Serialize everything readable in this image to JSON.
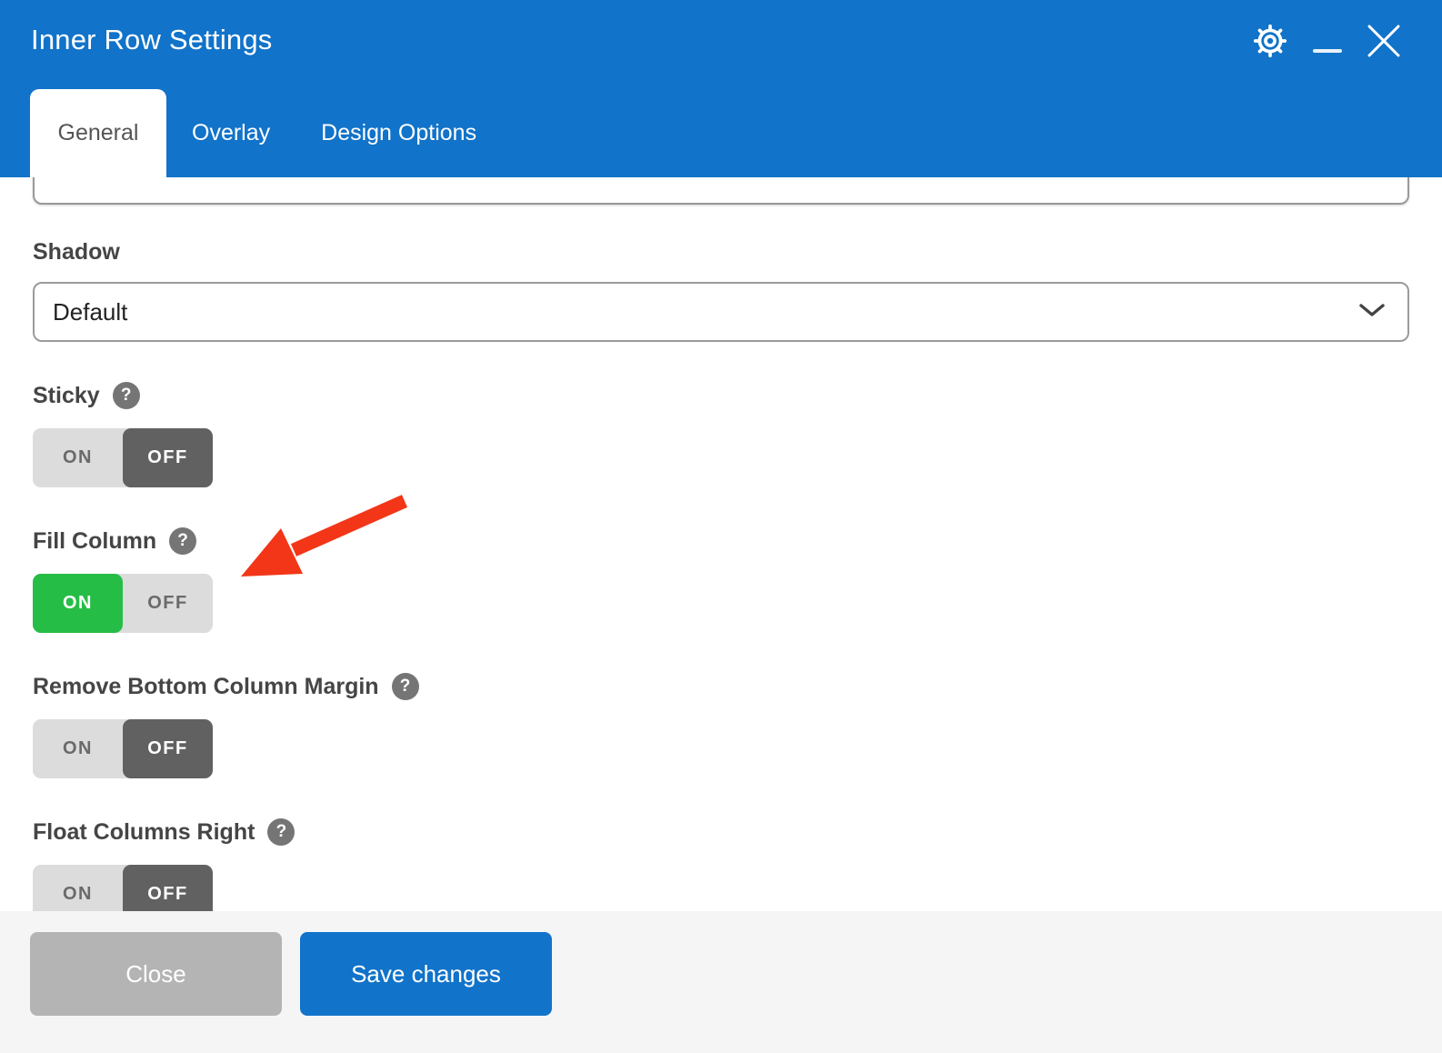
{
  "header": {
    "title": "Inner Row Settings",
    "icons": [
      "settings-icon",
      "minimize-icon",
      "close-icon"
    ]
  },
  "tabs": [
    {
      "label": "General",
      "active": true
    },
    {
      "label": "Overlay",
      "active": false
    },
    {
      "label": "Design Options",
      "active": false
    }
  ],
  "form": {
    "shadow_label": "Shadow",
    "shadow_value": "Default",
    "sections": [
      {
        "label": "Sticky",
        "value": "OFF",
        "has_help": true
      },
      {
        "label": "Fill Column",
        "value": "ON",
        "has_help": true
      },
      {
        "label": "Remove Bottom Column Margin",
        "value": "OFF",
        "has_help": true
      },
      {
        "label": "Float Columns Right",
        "value": "OFF",
        "has_help": true
      }
    ]
  },
  "controls": {
    "on": "ON",
    "off": "OFF",
    "help_glyph": "?"
  },
  "annotation": {
    "type": "red-arrow",
    "points_at": "Fill Column ON toggle",
    "color": "#f23617"
  },
  "footer": {
    "close_label": "Close",
    "save_label": "Save changes"
  },
  "colors": {
    "header_blue": "#1173c9",
    "toggle_on_green": "#26bd47",
    "toggle_off_dark": "#616161",
    "toggle_inactive_gray": "#dcdcdc",
    "footer_bg": "#f5f5f6",
    "close_button_gray": "#b4b4b4"
  }
}
